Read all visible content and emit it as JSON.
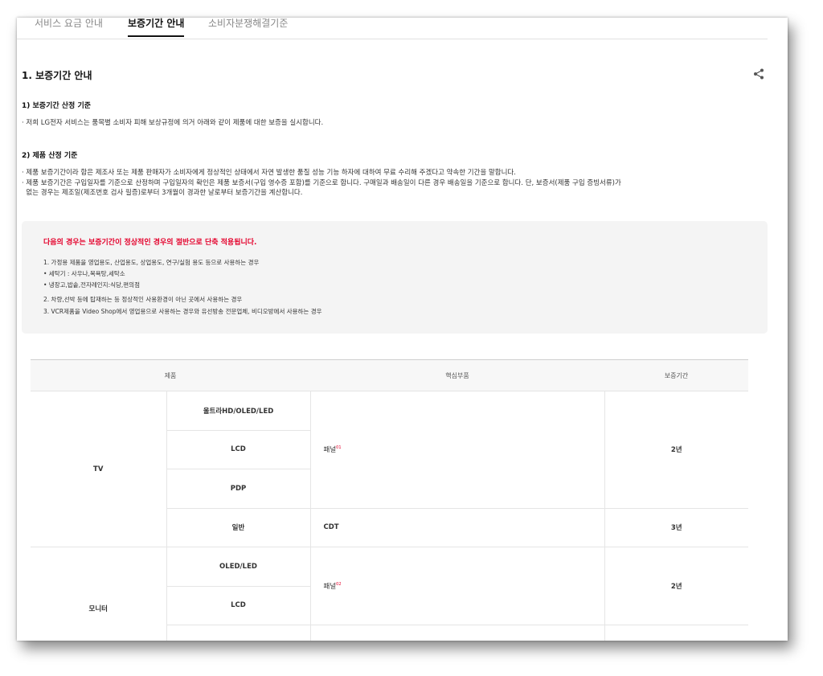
{
  "tabs": [
    {
      "label": "서비스 요금 안내"
    },
    {
      "label": "보증기간 안내"
    },
    {
      "label": "소비자분쟁해결기준"
    }
  ],
  "section": {
    "title": "1. 보증기간 안내",
    "share_icon": "share-icon"
  },
  "subsections": [
    {
      "title": "1) 보증기간 산정 기준",
      "lines": [
        "· 저희 LG전자 서비스는 품목별 소비자 피해 보상규정에 의거 아래와 같이 제품에 대한 보증을 실시합니다."
      ]
    },
    {
      "title": "2) 제품 산정 기준",
      "lines": [
        "· 제품 보증기간이라 함은 제조사 또는 제품 판매자가 소비자에게 정상적인 상태에서 자연 발생한 품질 성능 기능 하자에 대하여 무료 수리해 주겠다고 약속한 기간을 말합니다.",
        "· 제품 보증기간은 구입일자를 기준으로 산정하며 구입일자의 확인은 제품 보증서(구입 영수증 포함)를 기준으로 합니다. 구매일과 배송일이 다른 경우 배송일을 기준으로 합니다. 단, 보증서(제품 구입 증빙서류)가",
        "  없는 경우는 제조일(제조번호 검사 필증)로부터 3개월이 경과한 날로부터 보증기간을 계산합니다."
      ]
    }
  ],
  "notice": {
    "title": "다음의 경우는 보증기간이 정상적인 경우의 절반으로 단축 적용됩니다.",
    "items": [
      "1. 가정용 제품을 영업용도, 산업용도, 상업용도, 연구/실험 용도 등으로 사용하는 경우",
      "• 세탁기 : 사우나,목욕탕,세탁소",
      "• 냉장고,밥솥,전자레인지:식당,편의점",
      "2. 차량,선박 등에 탑재하는 등 정상적인 사용환경이 아닌 곳에서 사용하는 경우",
      "3. VCR제품을 Video Shop에서 영업용으로 사용하는 경우와 유선방송 전문업체, 비디오방에서 사용하는 경우"
    ]
  },
  "table": {
    "headers": [
      "제품",
      "핵심부품",
      "보증기간"
    ],
    "tv": {
      "category": "TV",
      "models": [
        "울트라HD/OLED/LED",
        "LCD",
        "PDP",
        "일반"
      ],
      "part_panel": "패널",
      "part_panel_note": "01",
      "part_cdt": "CDT",
      "period_panel": "2년",
      "period_cdt": "3년"
    },
    "monitor": {
      "category": "모니터",
      "models": [
        "OLED/LED",
        "LCD",
        ""
      ],
      "part_panel": "패널",
      "part_panel_note": "02",
      "period_panel": "2년"
    }
  },
  "colors": {
    "accent_red": "#e4002b",
    "notice_bg": "#f4f4f4",
    "header_bg": "#f7f7f7"
  }
}
